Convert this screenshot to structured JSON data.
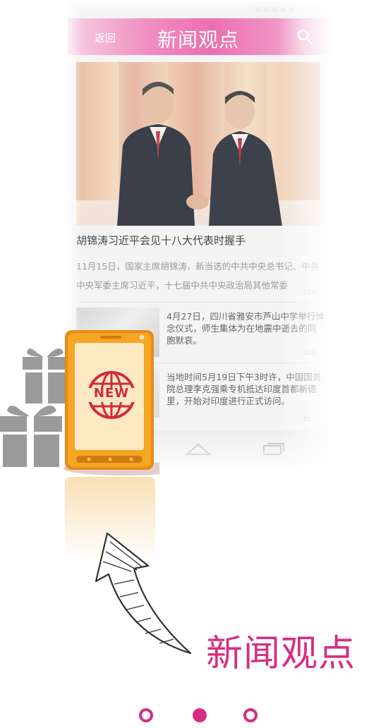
{
  "app_bar": {
    "back_label": "返回",
    "title": "新闻观点"
  },
  "featured": {
    "headline": "胡锦涛习近平会见十八大代表时握手",
    "summary": "11月15日，国家主席胡锦涛，新当选的中共中央总书记、中共中央军委主席习近平，十七届中共中央政治局其他常委",
    "meta": "188"
  },
  "news_items": [
    {
      "text": "4月27日，四川省雅安市芦山中学举行悼念仪式，师生集体为在地震中逝去的同胞默哀。",
      "meta": "106"
    },
    {
      "text": "当地时间5月19日下午3时许，中国国务院总理李克强乘专机抵达印度首都新德里，开始对印度进行正式访问。",
      "meta": "82"
    }
  ],
  "device_badge": "NEW",
  "slogan": "新闻观点",
  "pagination": {
    "total": 3,
    "active": 2
  },
  "colors": {
    "accent": "#d62e84",
    "appbar_pink": "#ec6fb0",
    "device_orange": "#f0a020"
  },
  "icons": [
    "search-icon",
    "home-icon",
    "recent-apps-icon",
    "gift-icon",
    "globe-icon",
    "arrow-icon"
  ]
}
